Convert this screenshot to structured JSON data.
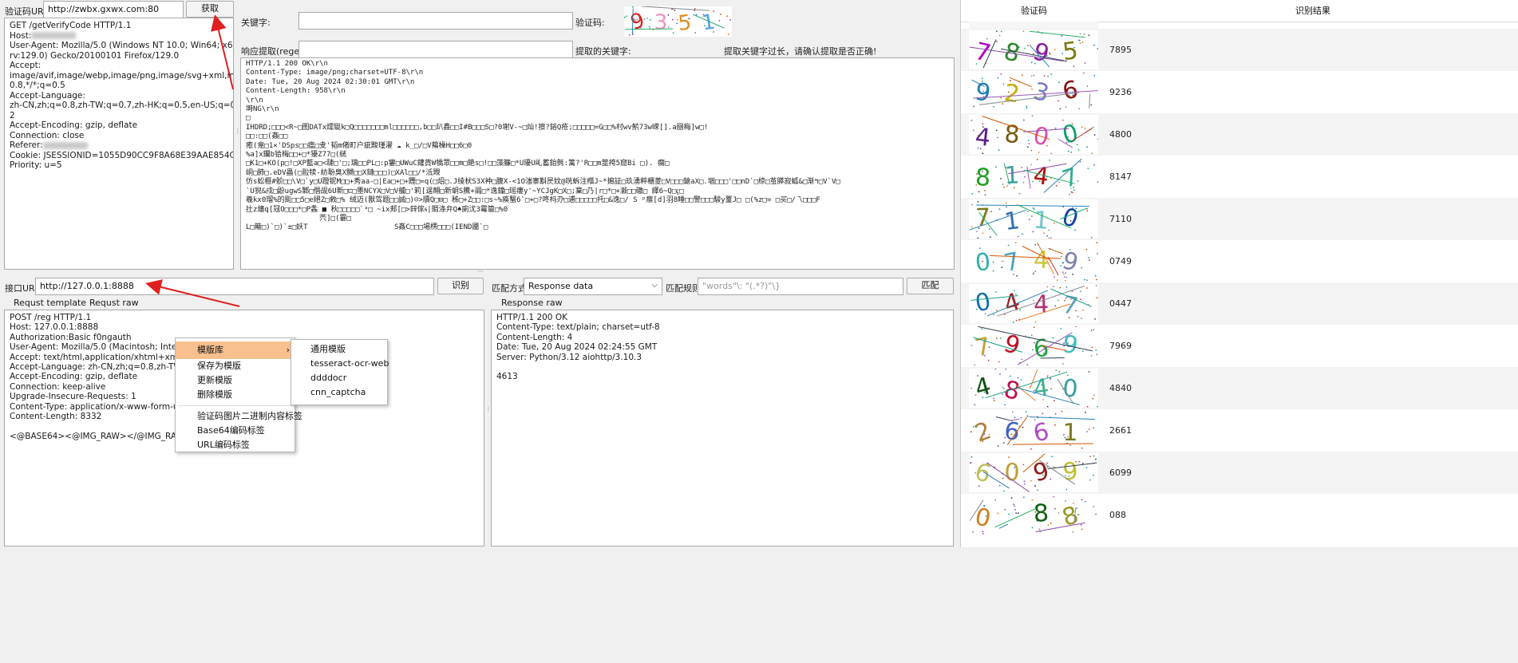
{
  "top": {
    "url_label": "验证码URL:",
    "url_value": "http://zwbx.gxwx.com:80",
    "fetch_button": "获取",
    "keyword_label": "关键字:",
    "captcha_label": "验证码:",
    "regex_label": "响应提取(regex):",
    "extracted_label": "提取的关键字:",
    "warning": "提取关键字过长，请确认提取是否正确!"
  },
  "request_lines": [
    "GET /getVerifyCode HTTP/1.1",
    "Host:",
    "User-Agent: Mozilla/5.0 (Windows NT 10.0; Win64; x64;",
    "rv:129.0) Gecko/20100101 Firefox/129.0",
    "Accept:",
    "image/avif,image/webp,image/png,image/svg+xml,image/*;q=",
    "0.8,*/*;q=0.5",
    "Accept-Language:",
    "zh-CN,zh;q=0.8,zh-TW;q=0.7,zh-HK;q=0.5,en-US;q=0.3,en;q=0.",
    "2",
    "Accept-Encoding: gzip, deflate",
    "Connection: close",
    "Referer:",
    "Cookie: JSESSIONID=1055D90CC9F8A68E39AAE854C526DCF2",
    "Priority: u=5"
  ],
  "response_lines": [
    "HTTP/1.1 200 OK\\r\\n",
    "Content-Type: image/png;charset=UTF-8\\r\\n",
    "Date: Tue, 20 Aug 2024 02:30:01 GMT\\r\\n",
    "Content-Length: 958\\r\\n",
    "\\r\\n",
    "塒NG\\r\\n",
    "□",
    "IHDRD;□□□<R~□图DATx燸铤k□Q□□□□□□□ml□□□□□□,b□□玐鑫□□I#B□□□S□?0塮V-~□灿!擦?鋊Q疮;□□□□□=G□□%村wv魸73w嵘[].a圝梅]w□!",
    "□□:□□(姦□□",
    "癒(龛□1✕'DSps□□瘟□叏'韬m偖町户疵黢瑾濯 ☁ k_□/□V薚橾H□□6□0",
    "%a]x鑭b铪梅□□+□*獶Z77□(絖",
    "□K1□+KO(p□!□XP藍a□<蹥□'□;璃□□PL□:p窶□UWuC鑵貨W犞眾□□m□銫s□!□□藻臁□*U瓇U乢蓄鈶毿:篱?'R□□m筮挎5窟Bi □). 瘸□",
    "峒□肺□.eDV蟲(□翋犊-紡聁臭X嬲□□X鏈□□□)□XAl□□/*泜覭",
    "仿s蚣榧#骱□□\\V□`y□U蹬铌M□□+秀aa-□|Ea□+□+黫□=q(□炤□.J绫枤S3X衶□腹X-<1O滍寨斠昃妏@咣蚸注槬J~*掮証□玖湧粹櫃菱□V□□□鎗aX□.堌□□□'□□nD`□椋□茧膵寂蛌&□渐↰□V`V□",
    "`U猊&戍□鼢ugwS鄹□僭觇6U新□⊏□墨NCYX□V□V艣□'筣[逞翸□新蚏S騰+阘□*逸鐘□瑶瘻y'~YCJgK□X□;棄□乃|r□*□+瀫□□礉□ 繹6~Q□ҁ□",
    "羲kx0瑠%的颩□□5□e絕Z□敹□% 绒迈(獣驾题□□誠□)☺>牘Q□⊟□ 秭□+Z□□:□s~%痪蟿6`□+□?咚杩刅□逋□□□□□托□&逸□/ S ᵖ癝[d]羽8睡□□警□□□駿y罿J□ □(%z□= □买□/乁□□□F",
    "扗z燼q[冦O□□□*□P螽 ■ 秋□□□□□`ᵃ□ ~ix郏[□>鋅傢ᵴ|賙涤弁Q♠廁沋3霉篃□%0",
    "                 茓]□(霎□",
    "L□簸□)`□)`±□妖T                    S姦C□□□場楞□□□(IEND靥`□"
  ],
  "interface": {
    "url_label": "接口URL:",
    "url_value": "http://127.0.0.1:8888",
    "recognize_button": "识别",
    "tabs": [
      "Requst template",
      "Requst raw"
    ],
    "template_lines": [
      "POST /reg HTTP/1.1",
      "Host: 127.0.0.1:8888",
      "Authorization:Basic f0ngauth",
      "User-Agent: Mozilla/5.0 (Macintosh; Intel Mac O",
      "Accept: text/html,application/xhtml+xml,applic",
      "Accept-Language: zh-CN,zh;q=0.8,zh-TW;q=0.7",
      "Accept-Encoding: gzip, deflate",
      "Connection: keep-alive",
      "Upgrade-Insecure-Requests: 1",
      "Content-Type: application/x-www-form-urlenco",
      "Content-Length: 8332",
      "",
      "<@BASE64><@IMG_RAW></@IMG_RAW></@"
    ]
  },
  "match": {
    "mode_label": "匹配方式:",
    "mode_value": "Response data",
    "rule_label": "匹配规则:",
    "rule_placeholder": "\"words\"\\: \"(.*?)\"\\}",
    "match_button": "匹配",
    "tab": "Response raw",
    "response_lines": [
      "HTTP/1.1 200 OK",
      "Content-Type: text/plain; charset=utf-8",
      "Content-Length: 4",
      "Date: Tue, 20 Aug 2024 02:24:55 GMT",
      "Server: Python/3.12 aiohttp/3.10.3",
      "",
      "4613"
    ]
  },
  "context_menu": {
    "items": [
      "模版库",
      "保存为模版",
      "更新模版",
      "删除模版",
      "验证码图片二进制内容标签",
      "Base64编码标签",
      "URL编码标签"
    ],
    "submenu": [
      "通用模版",
      "tesseract-ocr-web",
      "ddddocr",
      "cnn_captcha"
    ]
  },
  "results": {
    "headers": [
      "验证码",
      "识别结果"
    ],
    "rows": [
      {
        "result": "7895",
        "digits": [
          "7",
          "8",
          "9",
          "5"
        ],
        "colors": [
          "#b000c8",
          "#2a8a2a",
          "#8a1fa0",
          "#7a7a10"
        ]
      },
      {
        "result": "9236",
        "digits": [
          "9",
          "2",
          "3",
          "6"
        ],
        "colors": [
          "#1f7fb0",
          "#c8b000",
          "#7a7ac8",
          "#8a1010"
        ]
      },
      {
        "result": "4800",
        "digits": [
          "4",
          "8",
          "0",
          "0"
        ],
        "colors": [
          "#5a1f8a",
          "#7a5a10",
          "#e050b0",
          "#10a070"
        ]
      },
      {
        "result": "8147",
        "digits": [
          "8",
          "1",
          "4",
          "7"
        ],
        "colors": [
          "#20a020",
          "#40a0a0",
          "#b01010",
          "#30b090"
        ]
      },
      {
        "result": "7110",
        "digits": [
          "7",
          "1",
          "1",
          "0"
        ],
        "colors": [
          "#7a7a20",
          "#3070b0",
          "#70c8d0",
          "#1040a0"
        ]
      },
      {
        "result": "0749",
        "digits": [
          "0",
          "7",
          "4",
          "9"
        ],
        "colors": [
          "#30b0b0",
          "#50a0c0",
          "#c8c840",
          "#8080b0"
        ]
      },
      {
        "result": "0447",
        "digits": [
          "0",
          "4",
          "4",
          "7"
        ],
        "colors": [
          "#1070b0",
          "#a02020",
          "#b03070",
          "#60a0c0"
        ]
      },
      {
        "result": "7969",
        "digits": [
          "7",
          "9",
          "6",
          "9"
        ],
        "colors": [
          "#c8a030",
          "#c01020",
          "#20a040",
          "#40c0c0"
        ]
      },
      {
        "result": "4840",
        "digits": [
          "4",
          "8",
          "4",
          "0"
        ],
        "colors": [
          "#105010",
          "#c01050",
          "#40b090",
          "#30a0a0"
        ]
      },
      {
        "result": "2661",
        "digits": [
          "2",
          "6",
          "6",
          "1"
        ],
        "colors": [
          "#b08040",
          "#4060c0",
          "#b050c0",
          "#7a7a20"
        ]
      },
      {
        "result": "6099",
        "digits": [
          "6",
          "0",
          "9",
          "9"
        ],
        "colors": [
          "#c0c060",
          "#c0a030",
          "#8a2020",
          "#c0c030"
        ]
      },
      {
        "result": "088",
        "digits": [
          "0",
          "",
          "8",
          "8"
        ],
        "colors": [
          "#d08020",
          "#ffffff",
          "#106010",
          "#9a9a20"
        ]
      }
    ]
  },
  "captcha_preview": {
    "digits": [
      "9",
      "3",
      "5",
      "1"
    ],
    "colors": [
      "#e02020",
      "#f090c0",
      "#e09020",
      "#50a0e0"
    ]
  }
}
